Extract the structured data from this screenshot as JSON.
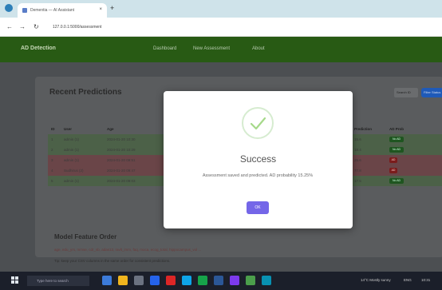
{
  "browser": {
    "tab_title": "Dementia — AI Assistant",
    "tab_close": "×",
    "new_tab": "+",
    "url": "127.0.0.1:5000/assessment",
    "back": "←",
    "forward": "→",
    "reload": "↻"
  },
  "navbar": {
    "brand": "AD Detection",
    "links": [
      "Dashboard",
      "New Assessment",
      "About"
    ]
  },
  "card": {
    "title": "Recent Predictions",
    "search_placeholder": "Search ID",
    "search_button": "Filter Status"
  },
  "table": {
    "headers": [
      "ID",
      "User",
      "Age",
      "Prediction",
      "AD Prob"
    ],
    "rows": [
      {
        "id": "1",
        "user": "admin (1)",
        "date": "2024-01-20 10:30",
        "prediction": "15.6",
        "badge": "No AD",
        "status": "ok"
      },
      {
        "id": "2",
        "user": "admin (1)",
        "date": "2024-01-20 10:29",
        "prediction": "18.4",
        "badge": "No AD",
        "status": "ok"
      },
      {
        "id": "3",
        "user": "admin (1)",
        "date": "2024-01-20 09:51",
        "prediction": "25.6",
        "badge": "AD",
        "status": "bad"
      },
      {
        "id": "4",
        "user": "Sudhirus (2)",
        "date": "2024-01-20 09:47",
        "prediction": "77.8",
        "badge": "AD",
        "status": "bad"
      },
      {
        "id": "5",
        "user": "admin (1)",
        "date": "2024-01-20 09:03",
        "prediction": "17.5",
        "badge": "No AD",
        "status": "ok"
      }
    ]
  },
  "features": {
    "title": "Model Feature Order",
    "list": "age, edu_yrs, mmse, cdr_sb, adas13, ravlt_imm, faq, moca, ecog_total, hippocampus_vol ...",
    "note": "Tip: keep your CSV columns in the same order for consistent predictions."
  },
  "modal": {
    "title": "Success",
    "message": "Assessment saved and predicted. AD probability 15.25%",
    "ok": "OK",
    "accent": "#7466e8",
    "icon": "check-icon"
  },
  "taskbar": {
    "search": "Type here to search",
    "weather": "14°C Mostly sunny",
    "time": "10:31",
    "lang": "ENG"
  },
  "colors": {
    "navbar": "#285a14",
    "row_ok": "#4c6148",
    "row_bad": "#6a4548"
  }
}
